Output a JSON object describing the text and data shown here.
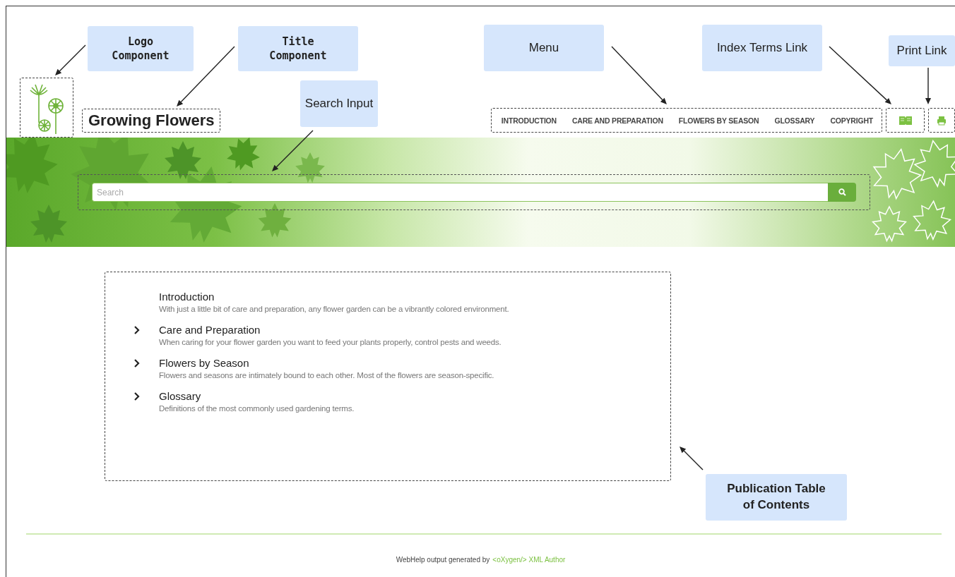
{
  "header": {
    "title": "Growing Flowers",
    "menu": [
      {
        "label": "INTRODUCTION"
      },
      {
        "label": "CARE AND PREPARATION"
      },
      {
        "label": "FLOWERS BY SEASON"
      },
      {
        "label": "GLOSSARY"
      },
      {
        "label": "COPYRIGHT"
      }
    ]
  },
  "search": {
    "placeholder": "Search"
  },
  "toc": [
    {
      "title": "Introduction",
      "description": "With just a little bit of care and preparation, any flower garden can be a vibrantly colored environment.",
      "expandable": false
    },
    {
      "title": "Care and Preparation",
      "description": "When caring for your flower garden you want to feed your plants properly, control pests and weeds.",
      "expandable": true
    },
    {
      "title": "Flowers by Season",
      "description": "Flowers and seasons are intimately bound to each other. Most of the flowers are season-specific.",
      "expandable": true
    },
    {
      "title": "Glossary",
      "description": "Definitions of the most commonly used gardening terms.",
      "expandable": true
    }
  ],
  "footer": {
    "text": "WebHelp output generated by",
    "link": "<oXygen/> XML Author"
  },
  "callouts": [
    {
      "text": "Logo Component",
      "kind": "mono"
    },
    {
      "text": "Title Component",
      "kind": "mono"
    },
    {
      "text": "Search Input",
      "kind": "plain"
    },
    {
      "text": "Menu",
      "kind": "plain"
    },
    {
      "text": "Index Terms Link",
      "kind": "plain"
    },
    {
      "text": "Print Link",
      "kind": "plain"
    },
    {
      "text": "Publication Table of Contents",
      "kind": "bold"
    }
  ]
}
